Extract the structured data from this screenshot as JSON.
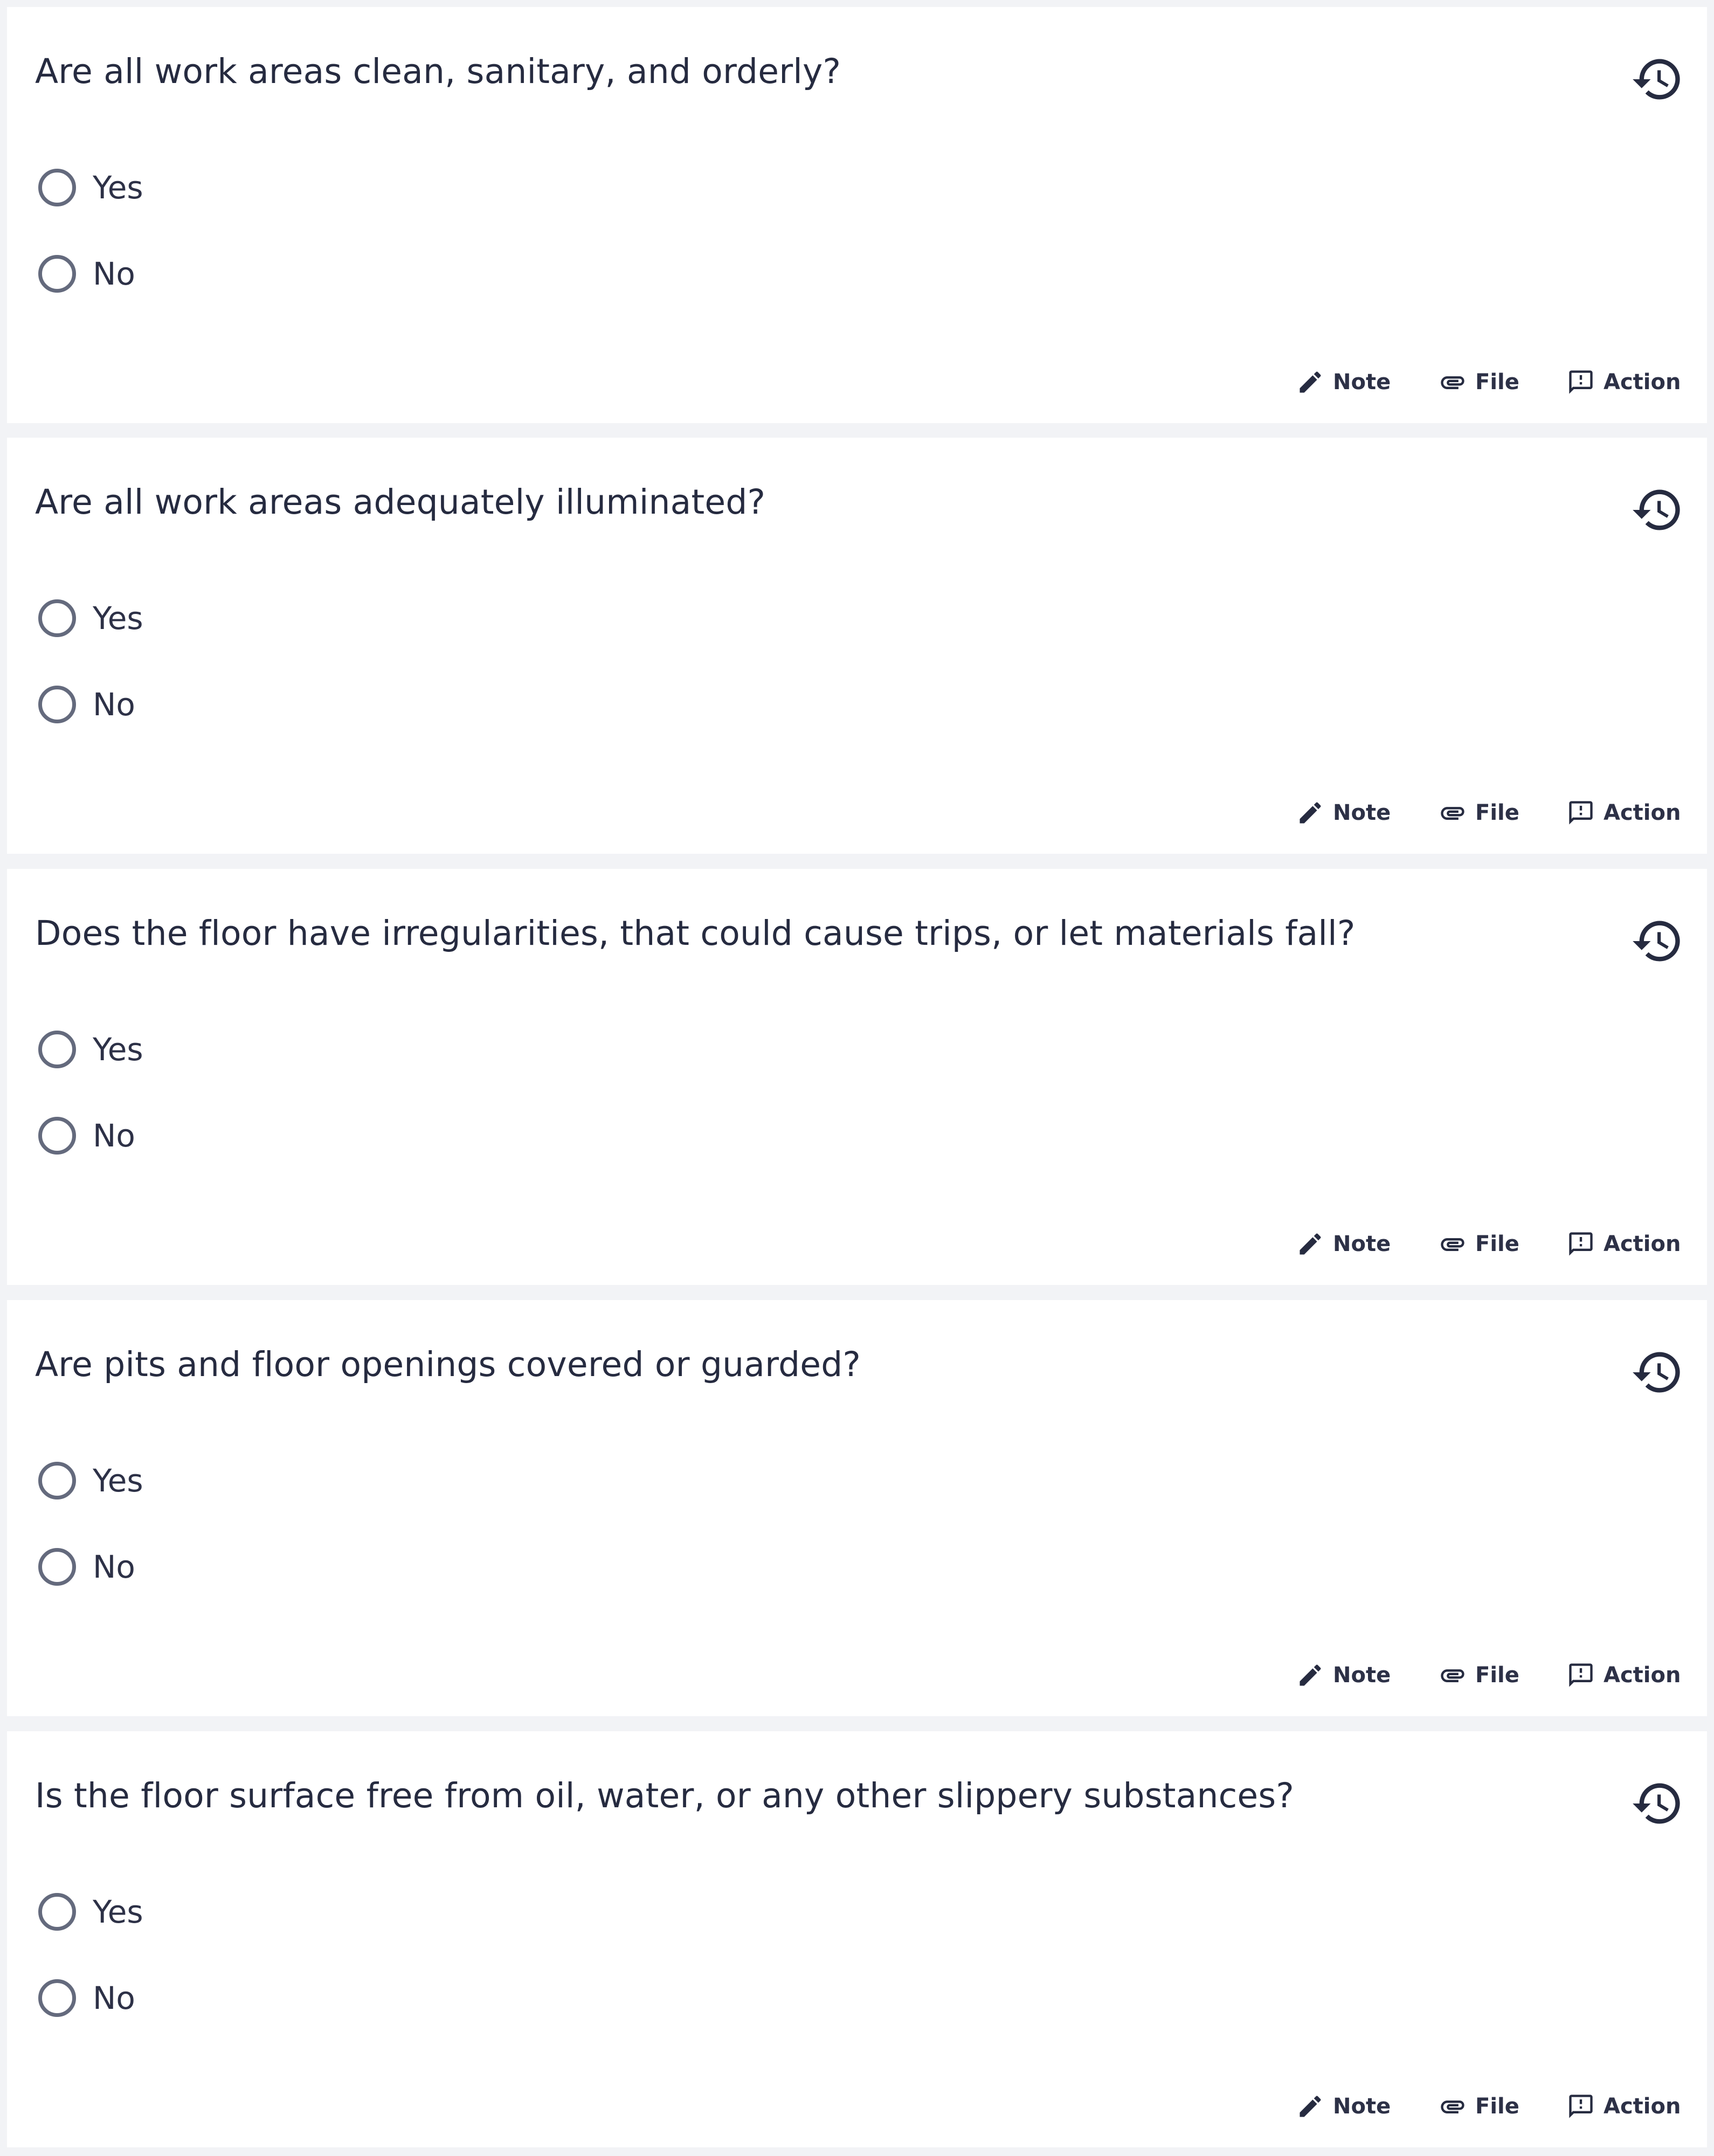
{
  "questions": [
    {
      "text": "Are all work areas clean, sanitary, and orderly?",
      "options": [
        "Yes",
        "No"
      ],
      "actions": {
        "note": "Note",
        "file": "File",
        "action": "Action"
      }
    },
    {
      "text": "Are all work areas adequately illuminated?",
      "options": [
        "Yes",
        "No"
      ],
      "actions": {
        "note": "Note",
        "file": "File",
        "action": "Action"
      }
    },
    {
      "text": "Does the floor have irregularities, that could cause trips, or let materials fall?",
      "options": [
        "Yes",
        "No"
      ],
      "actions": {
        "note": "Note",
        "file": "File",
        "action": "Action"
      }
    },
    {
      "text": "Are pits and floor openings covered or guarded?",
      "options": [
        "Yes",
        "No"
      ],
      "actions": {
        "note": "Note",
        "file": "File",
        "action": "Action"
      }
    },
    {
      "text": "Is the floor surface free from oil, water, or any other slippery substances?",
      "options": [
        "Yes",
        "No"
      ],
      "actions": {
        "note": "Note",
        "file": "File",
        "action": "Action"
      }
    }
  ],
  "icons": {
    "history": "history-icon",
    "note": "pencil-icon",
    "file": "paperclip-icon",
    "action": "comment-alert-icon"
  },
  "colors": {
    "background": "#f2f3f6",
    "card": "#ffffff",
    "text": "#262b40",
    "radio_border": "#646a7d"
  }
}
